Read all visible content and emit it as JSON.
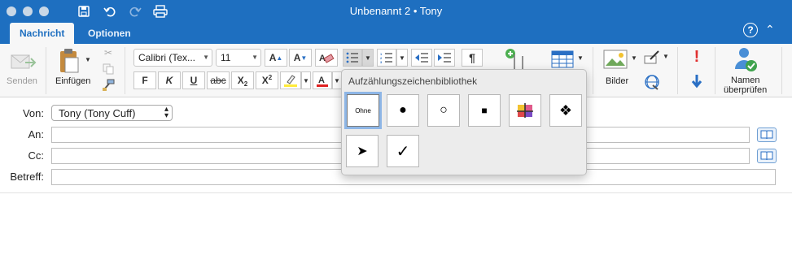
{
  "window": {
    "title": "Unbenannt 2 • Tony"
  },
  "tabs": [
    {
      "label": "Nachricht",
      "active": true
    },
    {
      "label": "Optionen",
      "active": false
    }
  ],
  "ribbon": {
    "send_label": "Senden",
    "paste_label": "Einfügen",
    "font_name": "Calibri (Tex...",
    "font_size": "11",
    "grow_font": "A",
    "shrink_font": "A",
    "bold": "F",
    "italic": "K",
    "underline": "U",
    "strikethrough": "abc",
    "subscript": "X",
    "subscript_small": "2",
    "superscript": "X",
    "superscript_small": "2",
    "pictures_label": "Bilder",
    "check_names_line1": "Namen",
    "check_names_line2": "überprüfen",
    "colors": {
      "highlight": "#ffeb3b",
      "font_color": "#e02020",
      "priority_high": "#e03030",
      "priority_low": "#2a6fc4",
      "accent": "#1e6fc0"
    }
  },
  "header_fields": {
    "from_label": "Von:",
    "from_value": "Tony (Tony Cuff)",
    "to_label": "An:",
    "cc_label": "Cc:",
    "subject_label": "Betreff:"
  },
  "bullet_library": {
    "title": "Aufzählungszeichenbibliothek",
    "items": [
      {
        "label": "Ohne",
        "icon": "none",
        "selected": true
      },
      {
        "glyph": "●",
        "icon": "filled-circle-bullet-icon"
      },
      {
        "glyph": "○",
        "icon": "hollow-circle-bullet-icon"
      },
      {
        "glyph": "■",
        "icon": "filled-square-bullet-icon"
      },
      {
        "glyph": "",
        "icon": "colored-square-bullet-icon"
      },
      {
        "glyph": "❖",
        "icon": "diamond-bullet-icon"
      },
      {
        "glyph": "➤",
        "icon": "arrowhead-bullet-icon"
      },
      {
        "glyph": "✓",
        "icon": "checkmark-bullet-icon"
      }
    ]
  }
}
